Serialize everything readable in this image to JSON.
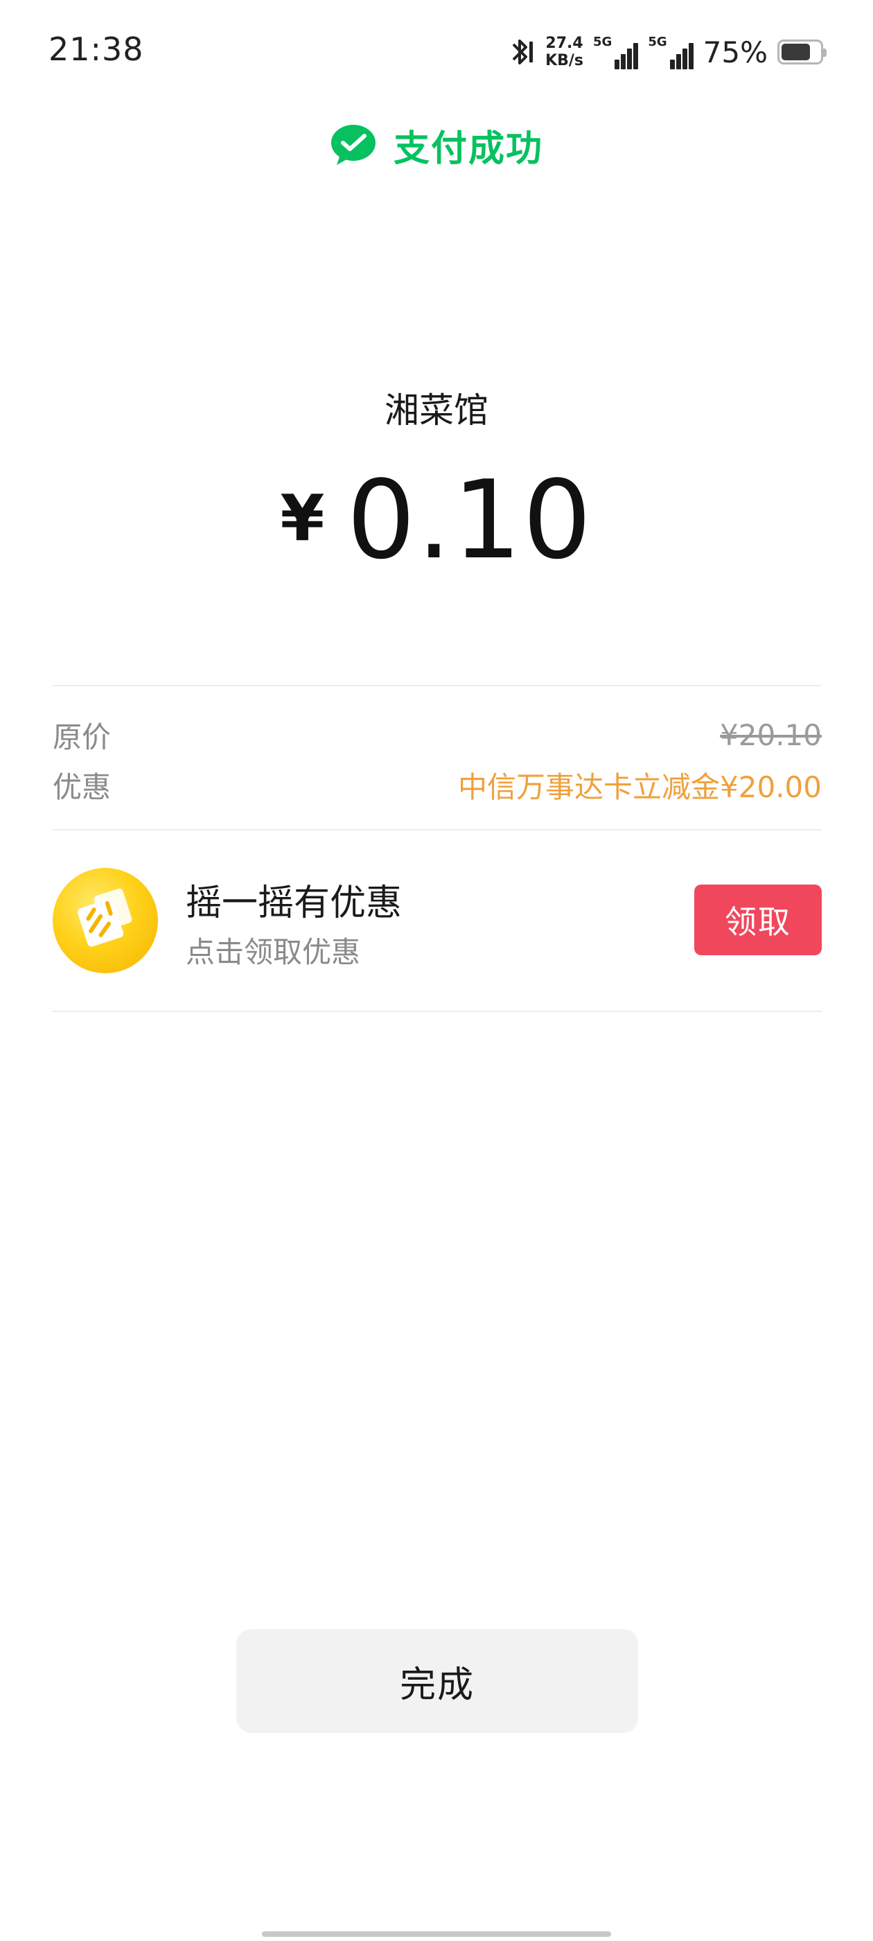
{
  "status_bar": {
    "time": "21:38",
    "net_speed_value": "27.4",
    "net_speed_unit": "KB/s",
    "sim1_tag": "5G",
    "sim2_tag": "5G",
    "battery_percent": "75%",
    "battery_level": 0.75
  },
  "header": {
    "status": "支付成功",
    "icon": "wechat-pay-check-icon",
    "color": "#07c160"
  },
  "payment": {
    "merchant": "湘菜馆",
    "currency_symbol": "¥",
    "amount": "0.10"
  },
  "breakdown": {
    "original_label": "原价",
    "original_value": "¥20.10",
    "discount_label": "优惠",
    "discount_value": "中信万事达卡立减金¥20.00",
    "discount_color": "#f0a03c"
  },
  "promo": {
    "icon": "shake-coupon-icon",
    "title": "摇一摇有优惠",
    "subtitle": "点击领取优惠",
    "claim_label": "领取",
    "claim_color": "#f0475d"
  },
  "footer": {
    "done_label": "完成"
  }
}
